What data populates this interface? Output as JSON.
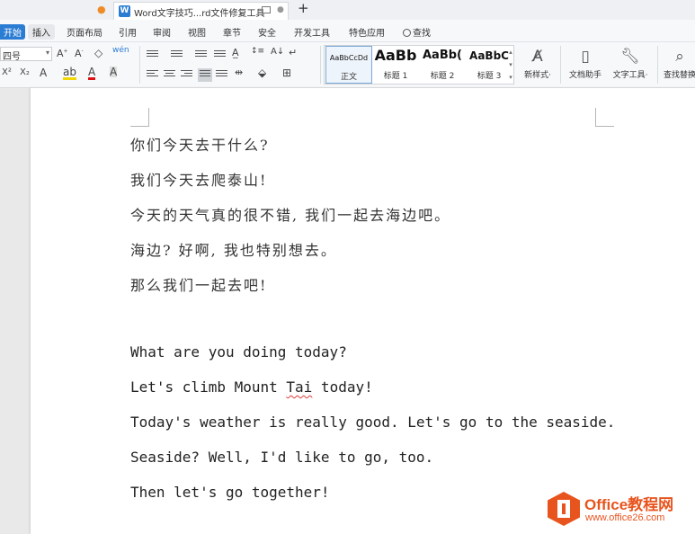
{
  "tabs": {
    "doc_tab_title": "Word文字技巧...rd文件修复工具",
    "new_tab_symbol": "+"
  },
  "menu": {
    "start": "开始",
    "insert": "插入",
    "items": [
      "页面布局",
      "引用",
      "审阅",
      "视图",
      "章节",
      "安全",
      "开发工具",
      "特色应用"
    ],
    "search": "查找"
  },
  "ribbon": {
    "font_size": "四号",
    "styles": [
      {
        "sample": "AaBbCcDd",
        "name": "正文"
      },
      {
        "sample": "AaBb",
        "name": "标题 1"
      },
      {
        "sample": "AaBb(",
        "name": "标题 2"
      },
      {
        "sample": "AaBbC",
        "name": "标题 3"
      }
    ],
    "new_style": "新样式·",
    "doc_assistant": "文档助手",
    "text_tools": "文字工具·",
    "find_replace": "查找替换"
  },
  "document": {
    "lines": [
      "你们今天去干什么?",
      "我们今天去爬泰山!",
      "今天的天气真的很不错, 我们一起去海边吧。",
      "海边? 好啊, 我也特别想去。",
      "那么我们一起去吧!",
      "What are you doing today?",
      "Let's climb Mount ",
      "Tai",
      " today!",
      "Today's weather is really good. Let's go to the seaside.",
      "Seaside? Well, I'd like to go, too.",
      "Then let's go together!"
    ]
  },
  "watermark": {
    "title": "Office教程网",
    "url": "www.office26.com"
  },
  "colors": {
    "accent": "#2b7cd3",
    "watermark": "#e8541e",
    "spellcheck": "#e03a3a"
  }
}
